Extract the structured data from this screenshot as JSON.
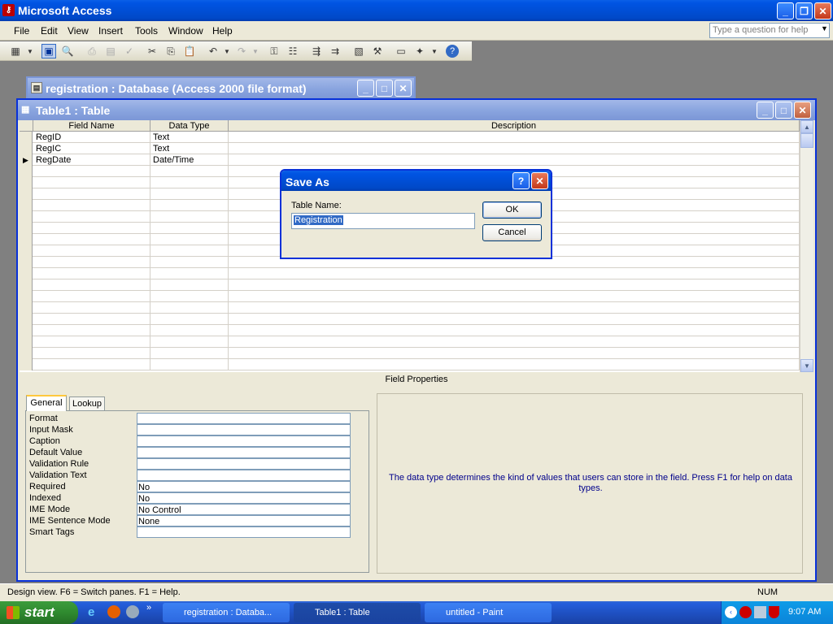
{
  "app": {
    "title": "Microsoft Access"
  },
  "menu": {
    "items": [
      "File",
      "Edit",
      "View",
      "Insert",
      "Tools",
      "Window",
      "Help"
    ],
    "help_placeholder": "Type a question for help"
  },
  "db_window": {
    "title": "registration : Database (Access 2000 file format)"
  },
  "table_window": {
    "title": "Table1 : Table",
    "columns": [
      "Field Name",
      "Data Type",
      "Description"
    ],
    "rows": [
      {
        "field": "RegID",
        "type": "Text",
        "desc": ""
      },
      {
        "field": "RegIC",
        "type": "Text",
        "desc": ""
      },
      {
        "field": "RegDate",
        "type": "Date/Time",
        "desc": ""
      }
    ]
  },
  "field_properties": {
    "title": "Field Properties",
    "tabs": [
      "General",
      "Lookup"
    ],
    "active_tab": "General",
    "rows": [
      {
        "label": "Format",
        "value": ""
      },
      {
        "label": "Input Mask",
        "value": ""
      },
      {
        "label": "Caption",
        "value": ""
      },
      {
        "label": "Default Value",
        "value": ""
      },
      {
        "label": "Validation Rule",
        "value": ""
      },
      {
        "label": "Validation Text",
        "value": ""
      },
      {
        "label": "Required",
        "value": "No"
      },
      {
        "label": "Indexed",
        "value": "No"
      },
      {
        "label": "IME Mode",
        "value": "No Control"
      },
      {
        "label": "IME Sentence Mode",
        "value": "None"
      },
      {
        "label": "Smart Tags",
        "value": ""
      }
    ],
    "help_text": "The data type determines the kind of values that users can store in the field.  Press F1 for help on data types."
  },
  "dialog": {
    "title": "Save As",
    "label": "Table Name:",
    "value": "Registration",
    "ok": "OK",
    "cancel": "Cancel"
  },
  "status_bar": {
    "text": "Design view.  F6 = Switch panes.  F1 = Help.",
    "num": "NUM"
  },
  "taskbar": {
    "start": "start",
    "tasks": [
      "registration : Databa...",
      "Table1 : Table",
      "untitled - Paint"
    ],
    "clock": "9:07 AM"
  },
  "colors": {
    "title_bar": "#0054e3",
    "face": "#ece9d8",
    "mdi_background": "#808080",
    "help_text": "#00008b"
  }
}
